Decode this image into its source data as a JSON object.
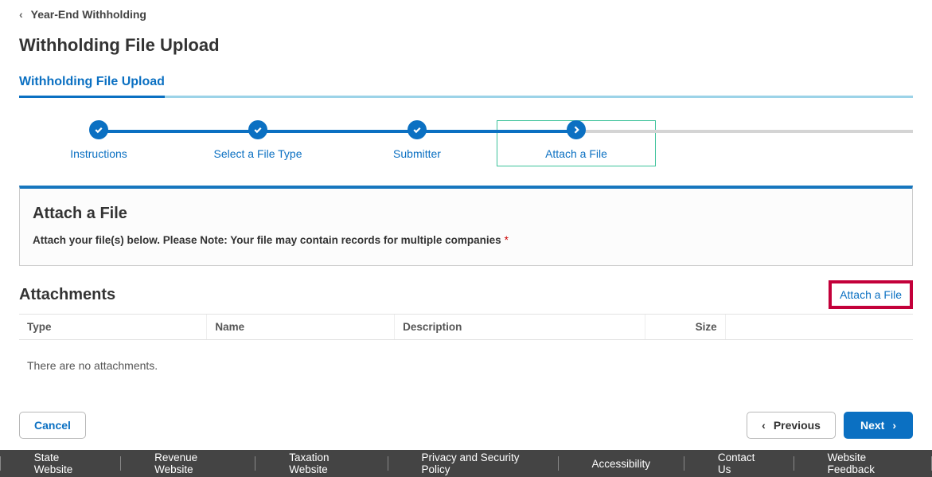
{
  "breadcrumb": {
    "label": "Year-End Withholding"
  },
  "page_title": "Withholding File Upload",
  "tab": {
    "label": "Withholding File Upload"
  },
  "stepper": {
    "steps": [
      {
        "label": "Instructions"
      },
      {
        "label": "Select a File Type"
      },
      {
        "label": "Submitter"
      },
      {
        "label": "Attach a File"
      }
    ]
  },
  "card": {
    "title": "Attach a File",
    "note": "Attach your file(s) below. Please Note: Your file may contain records for multiple companies"
  },
  "attachments": {
    "heading": "Attachments",
    "attach_link": "Attach a File",
    "columns": {
      "type": "Type",
      "name": "Name",
      "description": "Description",
      "size": "Size"
    },
    "empty": "There are no attachments."
  },
  "buttons": {
    "cancel": "Cancel",
    "previous": "Previous",
    "next": "Next"
  },
  "footer": {
    "links": [
      "State Website",
      "Revenue Website",
      "Taxation Website",
      "Privacy and Security Policy",
      "Accessibility",
      "Contact Us",
      "Website Feedback"
    ]
  }
}
